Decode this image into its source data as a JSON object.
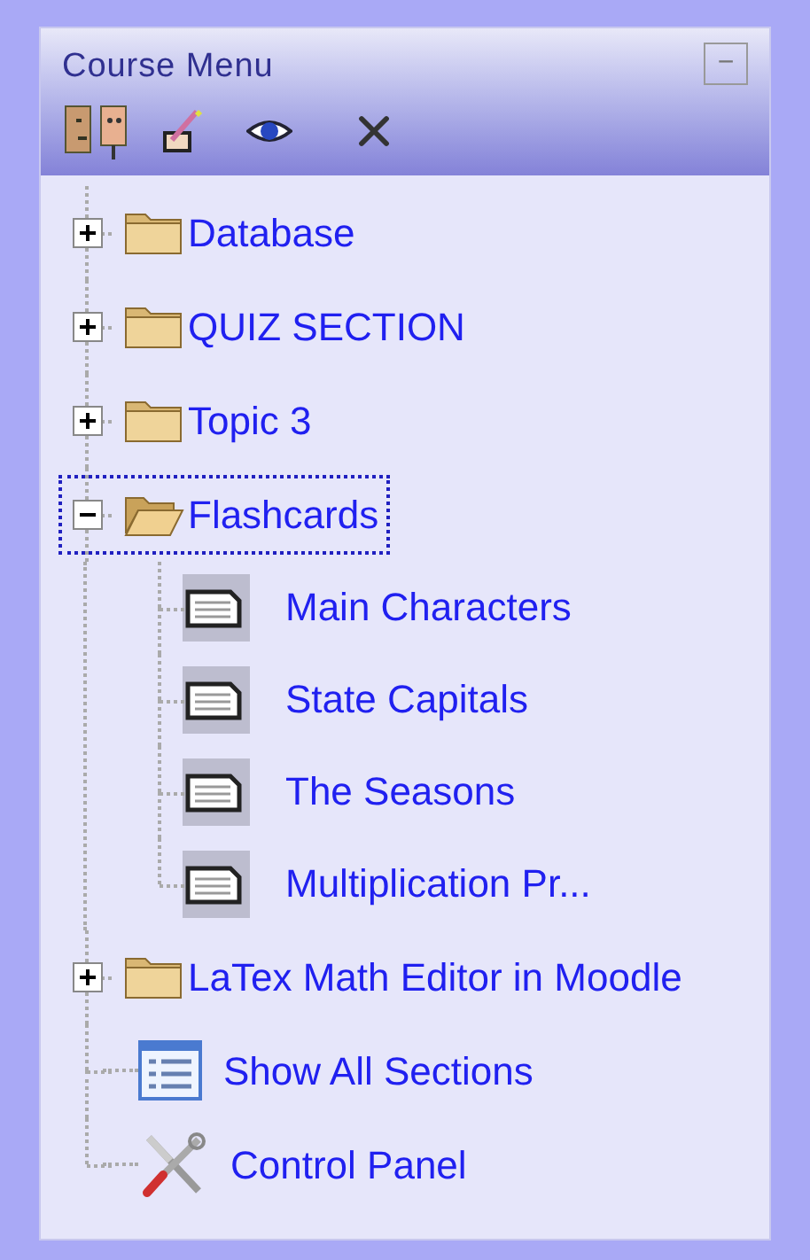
{
  "block": {
    "title": "Course Menu",
    "collapse_label": "−"
  },
  "tree": [
    {
      "kind": "folder",
      "label": "Database",
      "expanded": false,
      "selected": false
    },
    {
      "kind": "folder",
      "label": "QUIZ SECTION",
      "expanded": false,
      "selected": false
    },
    {
      "kind": "folder",
      "label": "Topic 3",
      "expanded": false,
      "selected": false
    },
    {
      "kind": "folder",
      "label": "Flashcards",
      "expanded": true,
      "selected": true,
      "children": [
        {
          "kind": "page",
          "label": "Main Characters"
        },
        {
          "kind": "page",
          "label": "State Capitals"
        },
        {
          "kind": "page",
          "label": "The Seasons"
        },
        {
          "kind": "page",
          "label": "Multiplication Pr..."
        }
      ]
    },
    {
      "kind": "folder",
      "label": "LaTex Math Editor in Moodle",
      "expanded": false,
      "selected": false
    },
    {
      "kind": "list",
      "label": "Show All Sections"
    },
    {
      "kind": "tools",
      "label": "Control Panel"
    }
  ]
}
